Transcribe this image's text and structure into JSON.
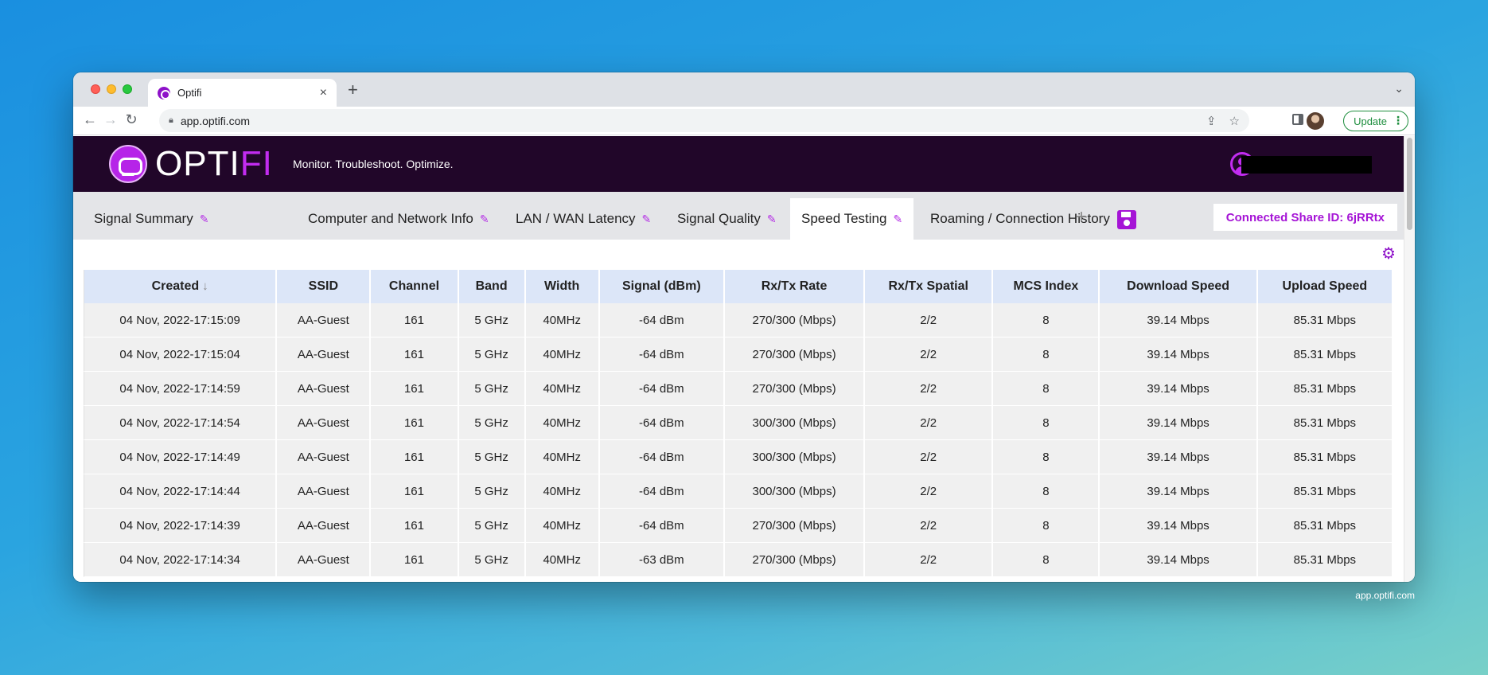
{
  "browser": {
    "tab_title": "Optifi",
    "tab_close": "×",
    "new_tab": "+",
    "url": "app.optifi.com",
    "update_label": "Update"
  },
  "app": {
    "logo_main": "OPTI",
    "logo_accent": "FI",
    "tagline": "Monitor. Troubleshoot. Optimize.",
    "tabs": [
      {
        "label": "Signal Summary"
      },
      {
        "label": "Computer and Network Info"
      },
      {
        "label": "LAN / WAN Latency"
      },
      {
        "label": "Signal Quality"
      },
      {
        "label": "Speed Testing"
      },
      {
        "label": "Roaming / Connection History"
      }
    ],
    "add_tab": "+",
    "share_label": "Connected Share ID: 6jRRtx",
    "accent_color": "#a514d6",
    "header_bg": "#210629"
  },
  "table": {
    "columns": [
      "Created",
      "SSID",
      "Channel",
      "Band",
      "Width",
      "Signal (dBm)",
      "Rx/Tx Rate",
      "Rx/Tx Spatial",
      "MCS Index",
      "Download Speed",
      "Upload Speed"
    ],
    "rows": [
      [
        "04 Nov, 2022-17:15:09",
        "AA-Guest",
        "161",
        "5 GHz",
        "40MHz",
        "-64 dBm",
        "270/300 (Mbps)",
        "2/2",
        "8",
        "39.14 Mbps",
        "85.31 Mbps"
      ],
      [
        "04 Nov, 2022-17:15:04",
        "AA-Guest",
        "161",
        "5 GHz",
        "40MHz",
        "-64 dBm",
        "270/300 (Mbps)",
        "2/2",
        "8",
        "39.14 Mbps",
        "85.31 Mbps"
      ],
      [
        "04 Nov, 2022-17:14:59",
        "AA-Guest",
        "161",
        "5 GHz",
        "40MHz",
        "-64 dBm",
        "270/300 (Mbps)",
        "2/2",
        "8",
        "39.14 Mbps",
        "85.31 Mbps"
      ],
      [
        "04 Nov, 2022-17:14:54",
        "AA-Guest",
        "161",
        "5 GHz",
        "40MHz",
        "-64 dBm",
        "300/300 (Mbps)",
        "2/2",
        "8",
        "39.14 Mbps",
        "85.31 Mbps"
      ],
      [
        "04 Nov, 2022-17:14:49",
        "AA-Guest",
        "161",
        "5 GHz",
        "40MHz",
        "-64 dBm",
        "300/300 (Mbps)",
        "2/2",
        "8",
        "39.14 Mbps",
        "85.31 Mbps"
      ],
      [
        "04 Nov, 2022-17:14:44",
        "AA-Guest",
        "161",
        "5 GHz",
        "40MHz",
        "-64 dBm",
        "300/300 (Mbps)",
        "2/2",
        "8",
        "39.14 Mbps",
        "85.31 Mbps"
      ],
      [
        "04 Nov, 2022-17:14:39",
        "AA-Guest",
        "161",
        "5 GHz",
        "40MHz",
        "-64 dBm",
        "270/300 (Mbps)",
        "2/2",
        "8",
        "39.14 Mbps",
        "85.31 Mbps"
      ],
      [
        "04 Nov, 2022-17:14:34",
        "AA-Guest",
        "161",
        "5 GHz",
        "40MHz",
        "-63 dBm",
        "270/300 (Mbps)",
        "2/2",
        "8",
        "39.14 Mbps",
        "85.31 Mbps"
      ]
    ]
  },
  "caption": "app.optifi.com"
}
